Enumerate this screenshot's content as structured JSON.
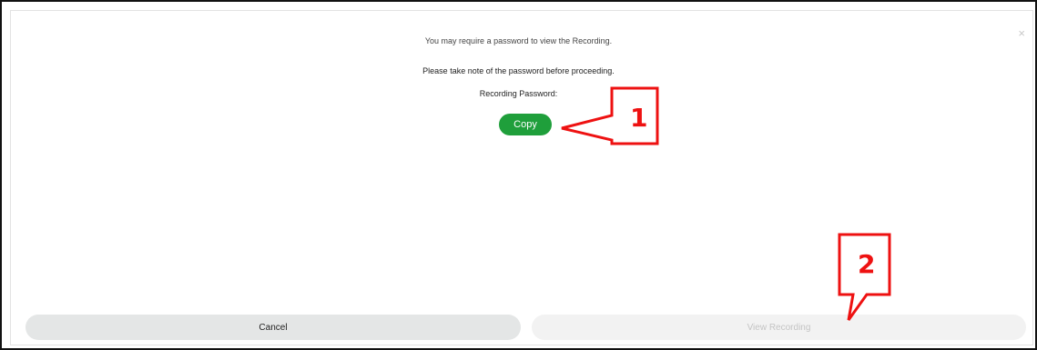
{
  "dialog": {
    "line1": "You may require a password to view the Recording.",
    "line2": "Please take note of the password before proceeding.",
    "password_label": "Recording Password:",
    "copy_label": "Copy",
    "close_glyph": "×",
    "cancel_label": "Cancel",
    "view_label": "View Recording"
  },
  "annotations": {
    "step1": "1",
    "step2": "2",
    "color": "#ee1111"
  },
  "colors": {
    "copy_button": "#1f9f3b",
    "cancel_button": "#e4e6e6",
    "view_button_disabled": "#f2f2f2"
  }
}
